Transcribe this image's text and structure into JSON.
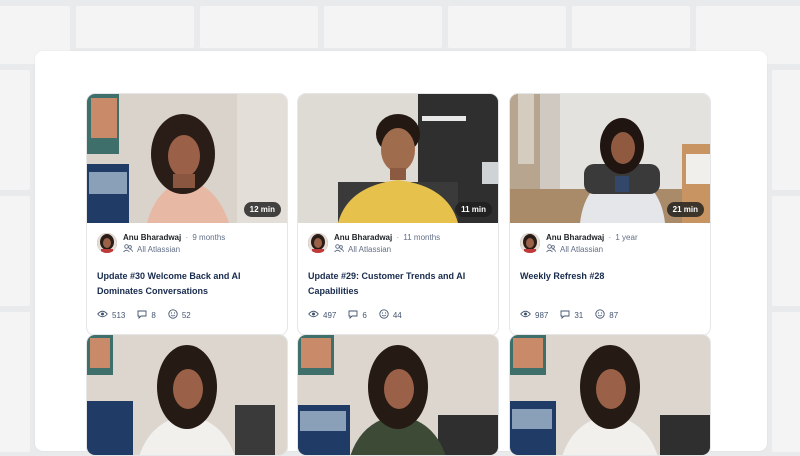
{
  "cards": [
    {
      "duration": "12 min",
      "author": "Anu Bharadwaj",
      "age": "9 months",
      "space": "All Atlassian",
      "title": "Update #30 Welcome Back and AI Dominates Conversations",
      "views": "513",
      "comments": "8",
      "reactions": "52"
    },
    {
      "duration": "11 min",
      "author": "Anu Bharadwaj",
      "age": "11 months",
      "space": "All Atlassian",
      "title": "Update #29: Customer Trends and AI Capabilities",
      "views": "497",
      "comments": "6",
      "reactions": "44"
    },
    {
      "duration": "21 min",
      "author": "Anu Bharadwaj",
      "age": "1 year",
      "space": "All Atlassian",
      "title": "Weekly Refresh #28",
      "views": "987",
      "comments": "31",
      "reactions": "87"
    }
  ],
  "colors": {
    "card_border": "#e5e6e8",
    "title": "#172b4d",
    "muted": "#626f86"
  },
  "icons": {
    "views": "eye-icon",
    "comments": "comment-icon",
    "reactions": "smiley-icon",
    "space": "people-icon"
  }
}
